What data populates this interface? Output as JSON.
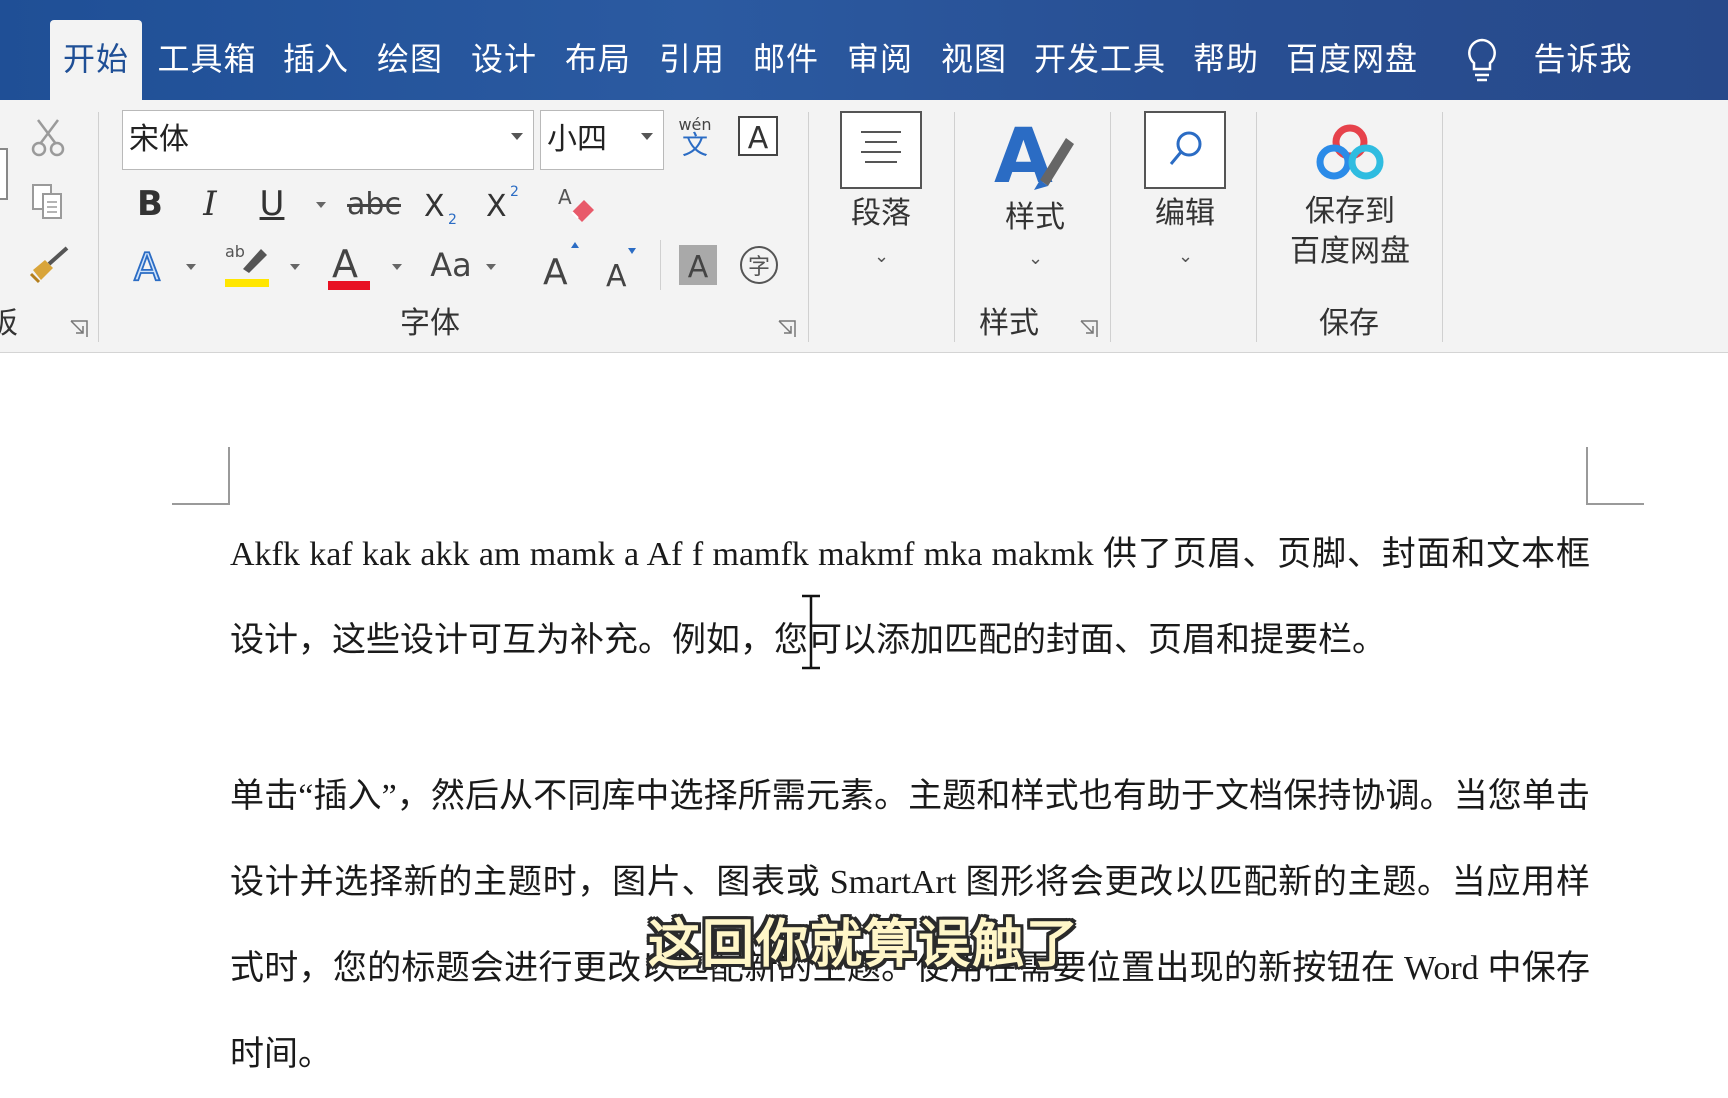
{
  "tabs": [
    {
      "label": "开始",
      "active": true
    },
    {
      "label": "工具箱"
    },
    {
      "label": "插入"
    },
    {
      "label": "绘图"
    },
    {
      "label": "设计"
    },
    {
      "label": "布局"
    },
    {
      "label": "引用"
    },
    {
      "label": "邮件"
    },
    {
      "label": "审阅"
    },
    {
      "label": "视图"
    },
    {
      "label": "开发工具"
    },
    {
      "label": "帮助"
    },
    {
      "label": "百度网盘"
    }
  ],
  "tell_me": "告诉我",
  "ribbon": {
    "clipboard_label_partial": "板",
    "font": {
      "name": "宋体",
      "size": "小四",
      "group_label": "字体",
      "phonetic_top": "wén",
      "phonetic_bottom": "文",
      "change_case": "Aa"
    },
    "paragraph_label": "段落",
    "styles_button": "样式",
    "styles_group_label": "样式",
    "editing_label": "编辑",
    "save_button_line1": "保存到",
    "save_button_line2": "百度网盘",
    "save_group_label": "保存"
  },
  "document": {
    "paragraph1": "Akfk kaf kak akk am mamk a Af f mamfk makmf mka makmk 供了页眉、页脚、封面和文本框设计，这些设计可互为补充。例如，您可以添加匹配的封面、页眉和提要栏。",
    "paragraph2": "单击“插入”，然后从不同库中选择所需元素。主题和样式也有助于文档保持协调。当您单击设计并选择新的主题时，图片、图表或 SmartArt 图形将会更改以匹配新的主题。当应用样式时，您的标题会进行更改以匹配新的主题。使用在需要位置出现的新按钮在 Word 中保存时间。"
  },
  "subtitle": "这回你就算误触了",
  "colors": {
    "tab_bar": "#2b5aa1",
    "ribbon_bg": "#f3f3f3",
    "highlight_yellow": "#ffe600",
    "font_color_red": "#e81123",
    "subtitle_fill": "#fff6c8"
  }
}
